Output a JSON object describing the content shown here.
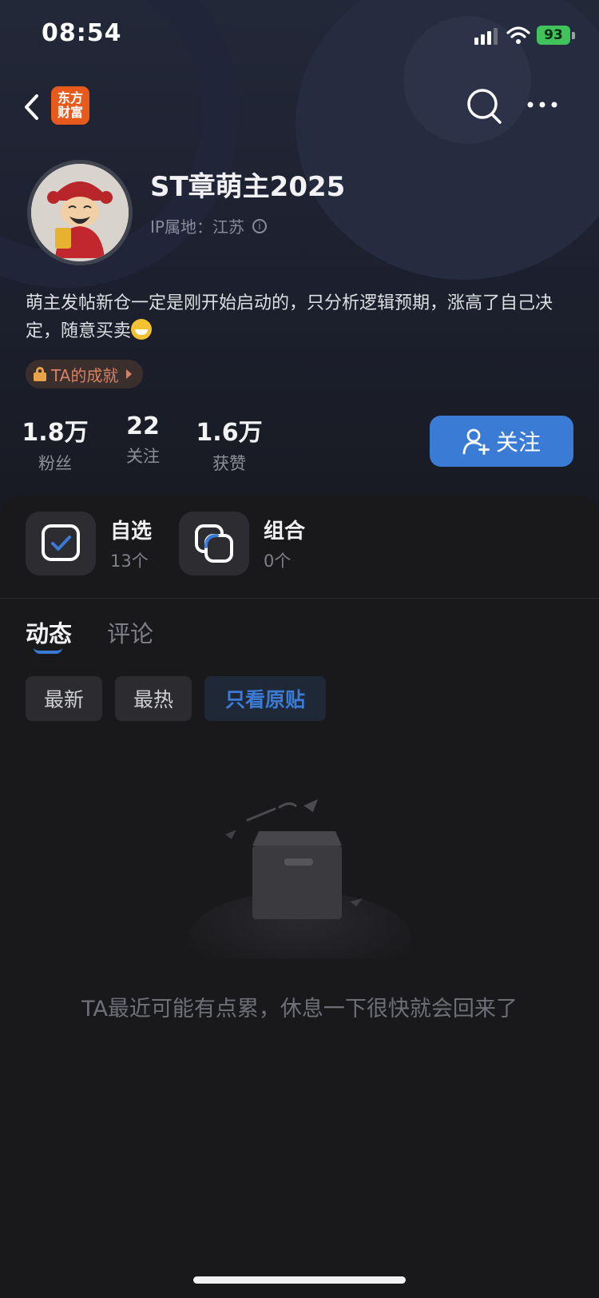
{
  "status_bar": {
    "time": "08:54",
    "battery": "93"
  },
  "nav": {
    "brand_line1": "东方",
    "brand_line2": "财富"
  },
  "profile": {
    "name": "ST章萌主2025",
    "ip_location": "IP属地：江苏",
    "bio": "萌主发帖新仓一定是刚开始启动的，只分析逻辑预期，涨高了自己决定，随意买卖",
    "achievement_label": "TA的成就"
  },
  "stats": [
    {
      "value": "1.8万",
      "label": "粉丝"
    },
    {
      "value": "22",
      "label": "关注"
    },
    {
      "value": "1.6万",
      "label": "获赞"
    }
  ],
  "follow_button": {
    "label": "关注"
  },
  "shortcuts": [
    {
      "title": "自选",
      "count": "13个"
    },
    {
      "title": "组合",
      "count": "0个"
    }
  ],
  "tabs": [
    {
      "label": "动态",
      "active": true
    },
    {
      "label": "评论",
      "active": false
    }
  ],
  "filters": [
    {
      "label": "最新",
      "active": false
    },
    {
      "label": "最热",
      "active": false
    },
    {
      "label": "只看原贴",
      "active": true
    }
  ],
  "empty_state": {
    "message": "TA最近可能有点累，休息一下很快就会回来了"
  },
  "colors": {
    "accent": "#3a7bd5",
    "brand": "#e85a1c",
    "battery": "#3fc35a",
    "achievement_text": "#d48164"
  }
}
